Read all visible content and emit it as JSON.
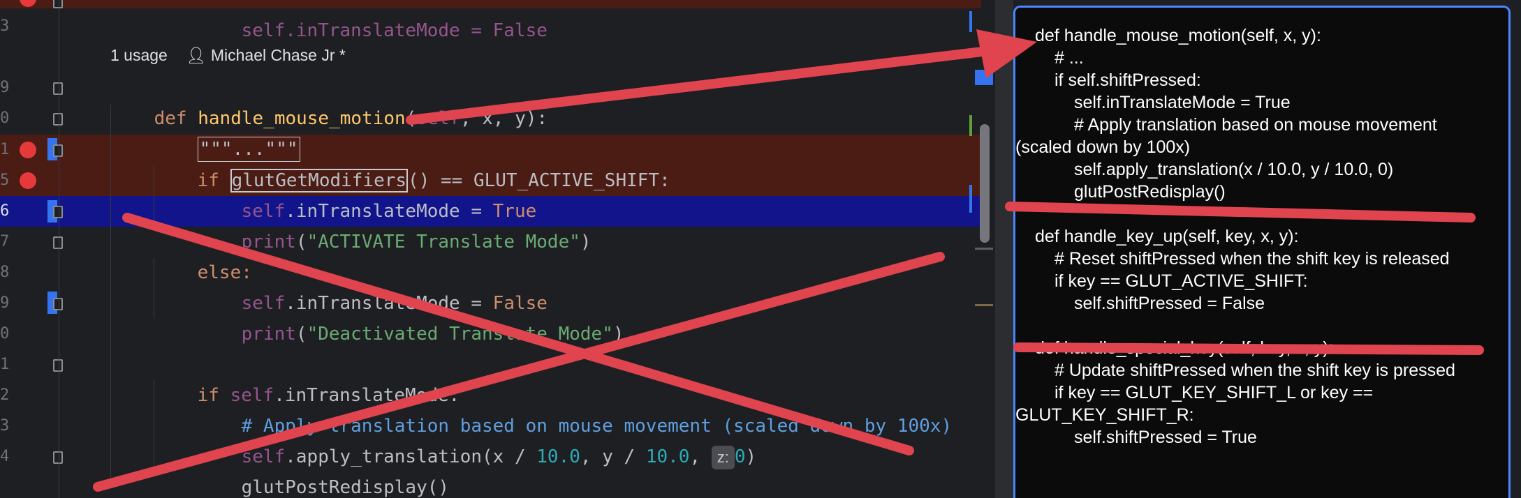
{
  "editor": {
    "line_numbers": [
      "3",
      "9",
      "0",
      "1",
      "5",
      "6",
      "7",
      "8",
      "9",
      "0",
      "1",
      "2",
      "3",
      "4"
    ],
    "hints": {
      "usage": "1 usage",
      "author": "Michael Chase Jr *"
    },
    "lines": {
      "top_partial": "self.inTranslateMode = False",
      "def_kw": "def ",
      "def_name": "handle_mouse_motion",
      "def_open": "(",
      "def_self": "self",
      "def_rest": ", x, y):",
      "docstring": "\"\"\"...\"\"\"",
      "if_kw": "if ",
      "if_fn": "glutGetModifiers",
      "if_rest": "() == GLUT_ACTIVE_SHIFT:",
      "assign_true_self": "self",
      "assign_true_rest": ".inTranslateMode = ",
      "assign_true_val": "True",
      "print1_fn": "print",
      "print1_open": "(",
      "print1_str": "\"ACTIVATE Translate Mode\"",
      "print1_close": ")",
      "else_kw": "else:",
      "assign_false_self": "self",
      "assign_false_rest": ".inTranslateMode = ",
      "assign_false_val": "False",
      "print2_fn": "print",
      "print2_open": "(",
      "print2_str": "\"Deactivated Translate Mode\"",
      "print2_close": ")",
      "if2_kw": "if ",
      "if2_self": "self",
      "if2_rest": ".inTranslateMode:",
      "comment": "# Apply translation based on mouse movement (scaled down by 100x)",
      "apply_self": "self",
      "apply_rest": ".apply_translation(x / ",
      "apply_num1": "10.0",
      "apply_mid": ", y / ",
      "apply_num2": "10.0",
      "apply_sep": ", ",
      "apply_hint": "z:",
      "apply_num3": "0",
      "apply_close": ")",
      "redisplay": "glutPostRedisplay()"
    }
  },
  "chat": {
    "lines": [
      "def handle_mouse_motion(self, x, y):",
      "# ...",
      "if self.shiftPressed:",
      "self.inTranslateMode = True",
      "# Apply translation based on mouse movement (scaled down by 100x)",
      "self.apply_translation(x / 10.0, y / 10.0, 0)",
      "glutPostRedisplay()",
      "def handle_key_up(self, key, x, y):",
      "# Reset shiftPressed when the shift key is released",
      "if key == GLUT_ACTIVE_SHIFT:",
      "self.shiftPressed = False",
      "def handle_special_key(self, key, x, y):",
      "# Update shiftPressed when the shift key is pressed",
      "if key == GLUT_KEY_SHIFT_L or key == GLUT_KEY_SHIFT_R:",
      "self.shiftPressed = True"
    ]
  },
  "colors": {
    "annotation": "#e0444f",
    "chat_border": "#4d86ff",
    "breakpoint": "#e5393c",
    "current_line": "#11148b"
  }
}
